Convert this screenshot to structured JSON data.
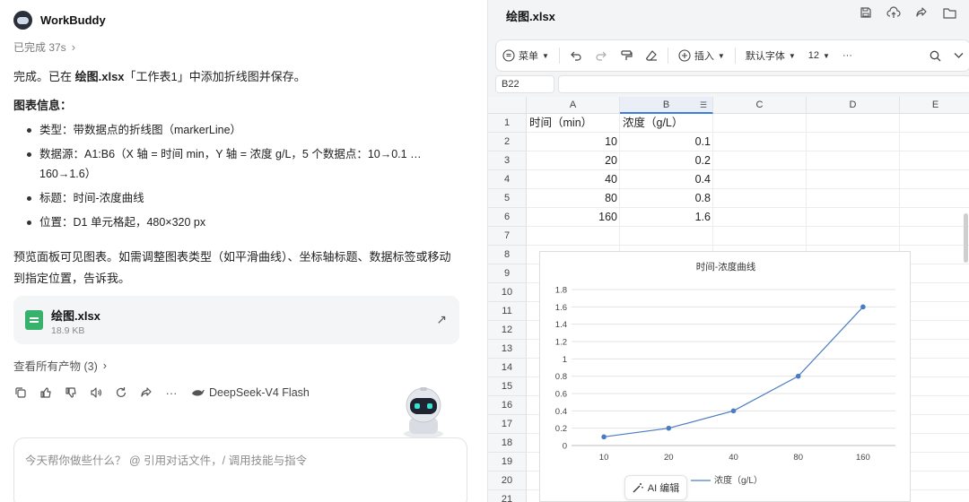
{
  "app": {
    "title": "WorkBuddy"
  },
  "status": {
    "text": "已完成 37s"
  },
  "message": {
    "done_text": "完成。已在 ",
    "file_bold": "绘图.xlsx",
    "done_rest": "「工作表1」中添加折线图并保存。",
    "chart_info_heading": "图表信息：",
    "info_items": [
      "类型：带数据点的折线图（markerLine）",
      "数据源：A1:B6（X 轴 = 时间 min，Y 轴 = 浓度 g/L，5 个数据点：10→0.1 … 160→1.6）",
      "标题：时间-浓度曲线",
      "位置：D1 单元格起，480×320 px"
    ],
    "preview_note": "预览面板可见图表。如需调整图表类型（如平滑曲线）、坐标轴标题、数据标签或移动到指定位置，告诉我。"
  },
  "file_card": {
    "name": "绘图.xlsx",
    "size": "18.9 KB"
  },
  "artifacts": {
    "label": "查看所有产物 (3)"
  },
  "model": {
    "name": "DeepSeek-V4 Flash"
  },
  "input": {
    "placeholder": "今天帮你做些什么？ @ 引用对话文件，/ 调用技能与指令"
  },
  "document": {
    "title": "绘图.xlsx"
  },
  "toolbar": {
    "menu": "菜单",
    "insert": "插入",
    "font": "默认字体",
    "font_size": "12",
    "more": "···"
  },
  "namebox": "B22",
  "sheet": {
    "columns": [
      "A",
      "B",
      "C",
      "D",
      "E"
    ],
    "rows": [
      "1",
      "2",
      "3",
      "4",
      "5",
      "6",
      "7",
      "8",
      "9",
      "10",
      "11",
      "12",
      "13",
      "14",
      "15",
      "16",
      "17",
      "18",
      "19",
      "20",
      "21"
    ],
    "header_a": "时间（min）",
    "header_b": "浓度（g/L）",
    "data": [
      {
        "a": "10",
        "b": "0.1"
      },
      {
        "a": "20",
        "b": "0.2"
      },
      {
        "a": "40",
        "b": "0.4"
      },
      {
        "a": "80",
        "b": "0.8"
      },
      {
        "a": "160",
        "b": "1.6"
      }
    ]
  },
  "ai_button": {
    "label": "AI 编辑"
  },
  "chart_data": {
    "type": "line",
    "title": "时间-浓度曲线",
    "categories": [
      "10",
      "20",
      "40",
      "80",
      "160"
    ],
    "series": [
      {
        "name": "浓度（g/L）",
        "values": [
          0.1,
          0.2,
          0.4,
          0.8,
          1.6
        ],
        "color": "#4a7cc4"
      }
    ],
    "yticks": [
      "0",
      "0.2",
      "0.4",
      "0.6",
      "0.8",
      "1",
      "1.2",
      "1.4",
      "1.6",
      "1.8"
    ],
    "ylim": [
      0,
      1.8
    ],
    "grid": true,
    "legend": "bottom",
    "xlabel": "",
    "ylabel": ""
  }
}
